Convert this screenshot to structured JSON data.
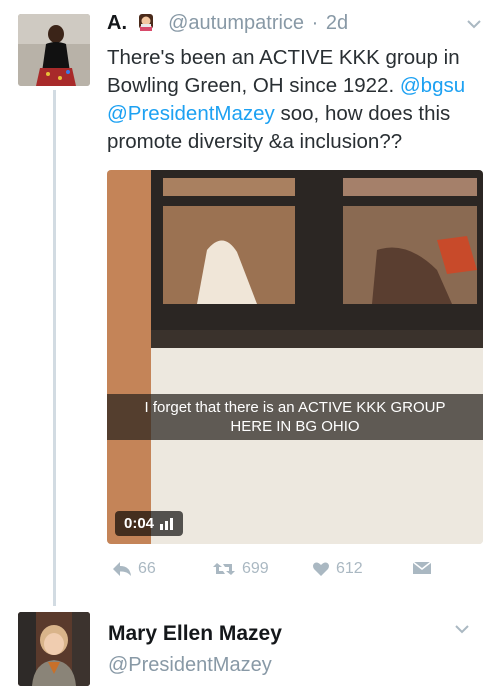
{
  "tweet": {
    "author_name": "A.",
    "author_badge_icon": "woman-emoji-icon",
    "handle": "@autumpatrice",
    "separator": "·",
    "time": "2d",
    "text_part1": "There's been an ACTIVE KKK group in Bowling Green, OH since 1922.",
    "mention1": "@bgsu",
    "mention2": "@PresidentMazey",
    "text_part2": "soo, how does this promote diversity &a inclusion??",
    "media": {
      "caption_line1": "I forget that there is an ACTIVE KKK GROUP",
      "caption_line2": "HERE IN BG OHIO",
      "duration": "0:04",
      "duration_icon": "volume-bars-icon"
    },
    "actions": {
      "reply_count": "66",
      "retweet_count": "699",
      "like_count": "612"
    }
  },
  "reply_author": {
    "name": "Mary Ellen Mazey",
    "handle": "@PresidentMazey"
  },
  "colors": {
    "link": "#1da1f2",
    "muted": "#8899a6",
    "icon": "#aab8c2",
    "thread_line": "#d2dbe2"
  }
}
